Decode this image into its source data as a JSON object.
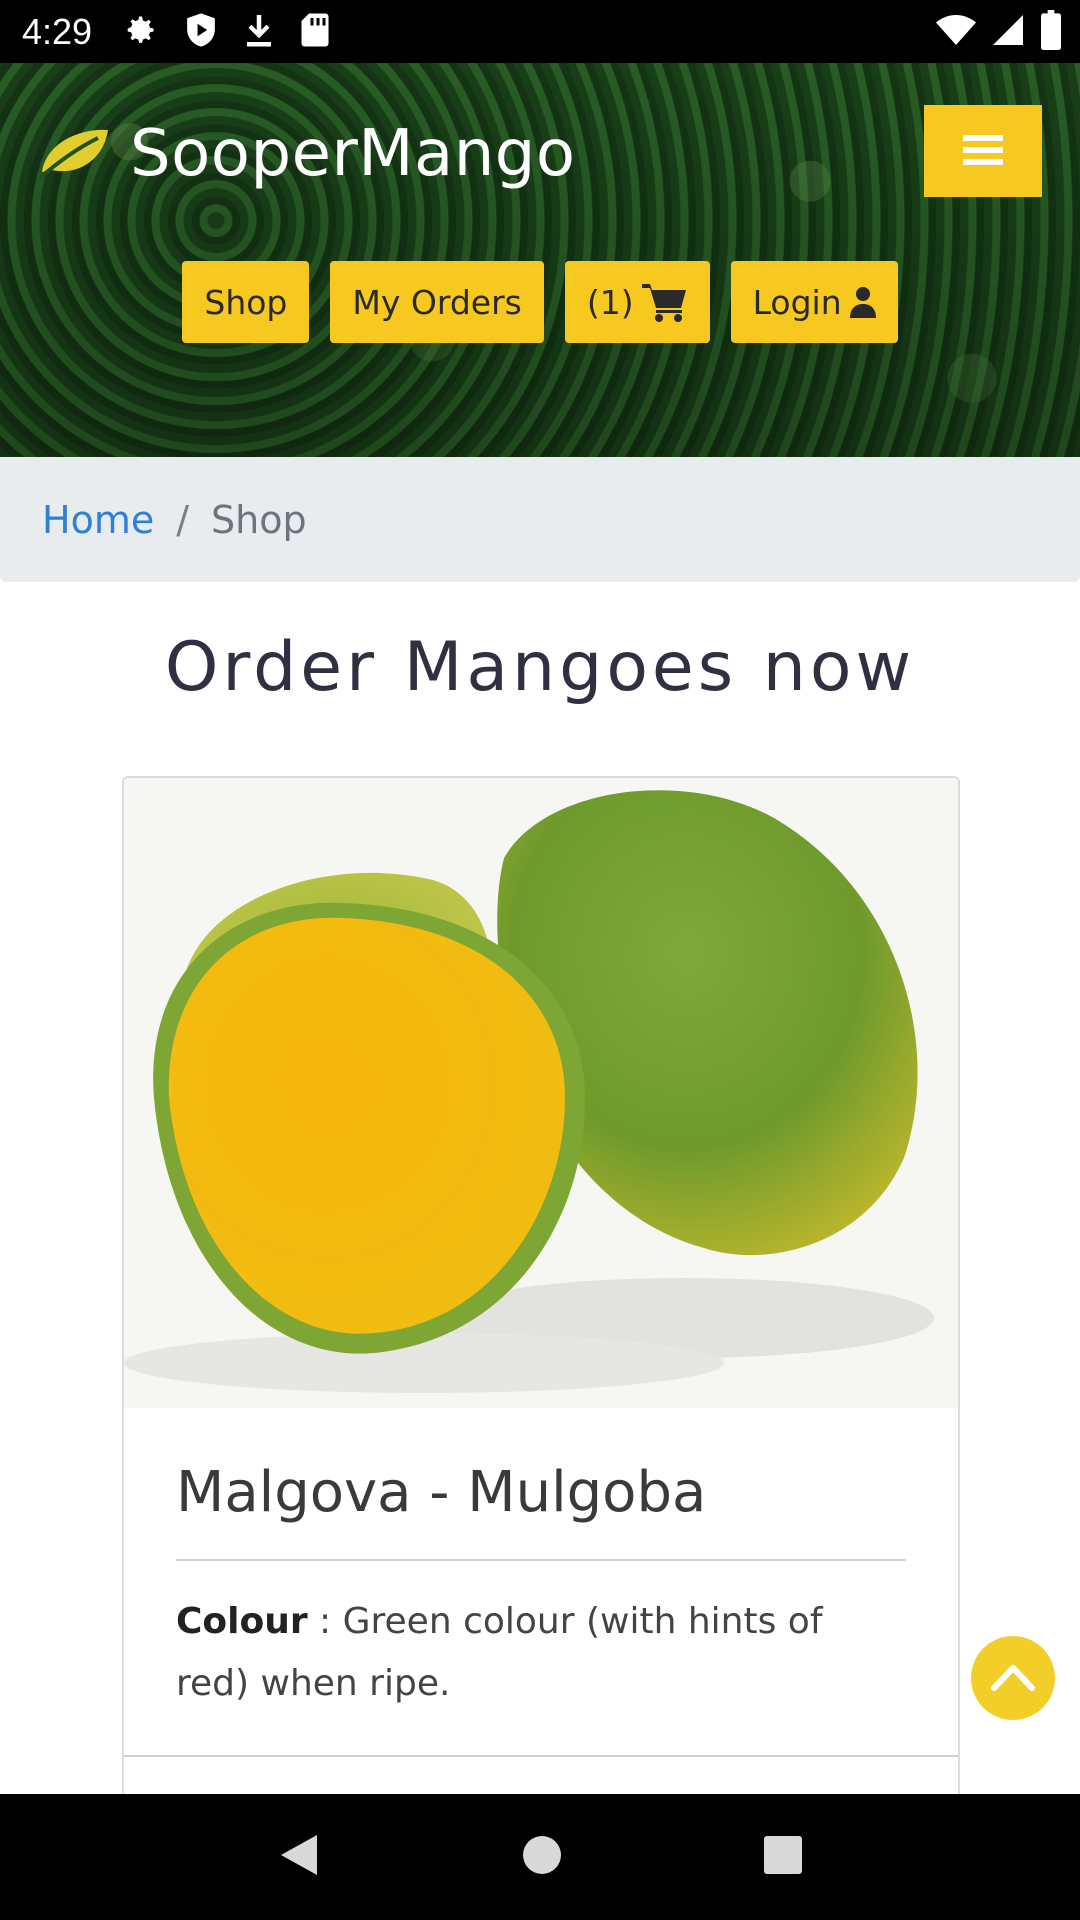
{
  "status_bar": {
    "time": "4:29",
    "left_icons": [
      "gear-icon",
      "shield-play-icon",
      "download-icon",
      "sd-card-icon"
    ],
    "right_icons": [
      "wifi-icon",
      "signal-icon",
      "battery-icon"
    ]
  },
  "header": {
    "brand_name": "SooperMango",
    "logo_icon": "leaf-icon",
    "menu_icon": "hamburger-icon",
    "nav": {
      "shop": "Shop",
      "my_orders": "My Orders",
      "cart_count": "(1)",
      "login": "Login"
    }
  },
  "breadcrumb": {
    "home": "Home",
    "separator": "/",
    "current": "Shop"
  },
  "page_title": "Order Mangoes now",
  "product": {
    "name": "Malgova - Mulgoba",
    "attributes": [
      {
        "label": "Colour",
        "value": " : Green colour (with hints of red) when ripe."
      }
    ]
  },
  "colors": {
    "accent_yellow": "#f7c81f",
    "link_blue": "#2f7fd6",
    "breadcrumb_bg": "#e9ecef"
  }
}
